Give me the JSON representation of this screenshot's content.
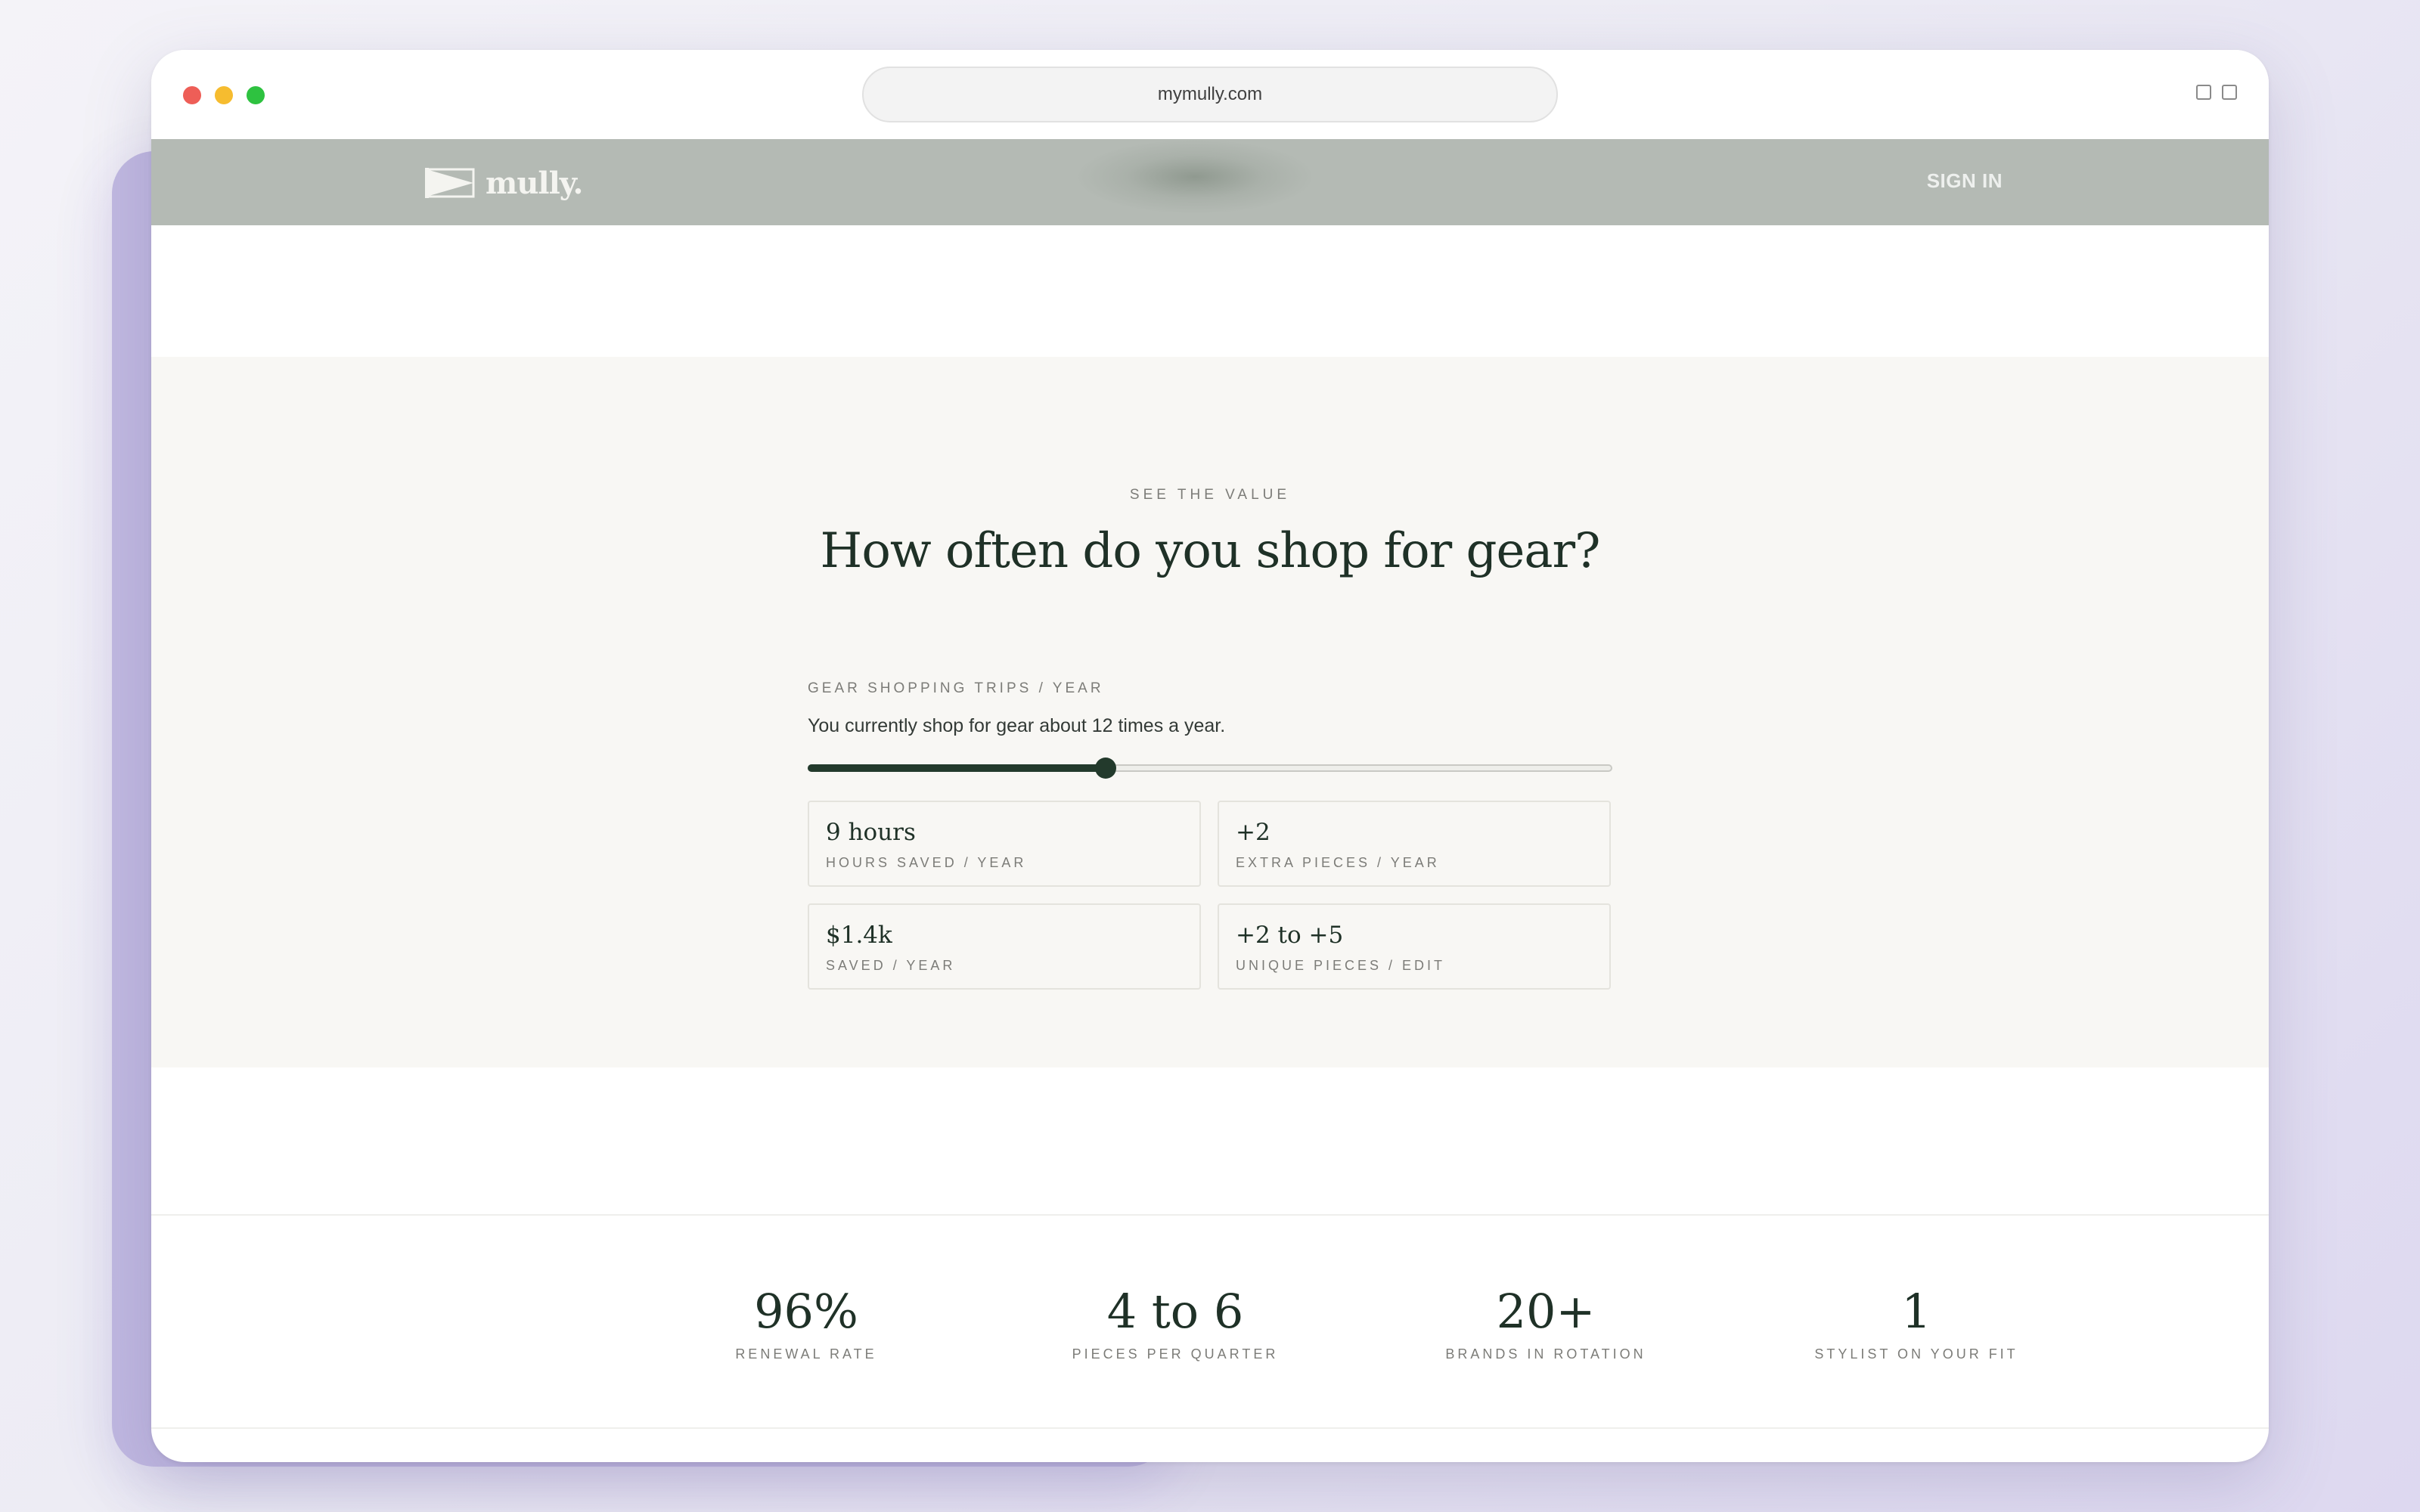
{
  "browser": {
    "url": "mymully.com",
    "traffic_lights": {
      "close": "#ee5e57",
      "minimize": "#f6bc2f",
      "maximize": "#2ec240"
    }
  },
  "site_header": {
    "logo_text": "mully.",
    "signin_label": "SIGN IN"
  },
  "value_section": {
    "eyebrow": "SEE THE VALUE",
    "headline": "How often do you shop for gear?",
    "calculator": {
      "label": "GEAR SHOPPING TRIPS / YEAR",
      "description": "You currently shop for gear about 12 times a year.",
      "slider_value_fraction": 0.37,
      "stats": [
        {
          "value": "9 hours",
          "label": "HOURS SAVED / YEAR"
        },
        {
          "value": "+2",
          "label": "EXTRA PIECES / YEAR"
        },
        {
          "value": "$1.4k",
          "label": "SAVED / YEAR"
        },
        {
          "value": "+2 to +5",
          "label": "UNIQUE PIECES / EDIT"
        }
      ]
    }
  },
  "metrics": [
    {
      "value": "96%",
      "label": "RENEWAL RATE"
    },
    {
      "value": "4 to 6",
      "label": "PIECES PER QUARTER"
    },
    {
      "value": "20+",
      "label": "BRANDS IN ROTATION"
    },
    {
      "value": "1",
      "label": "STYLIST ON YOUR FIT"
    }
  ],
  "colors": {
    "brand_green": "#1f3127",
    "header_bg": "#b4bab4",
    "section_bg": "#f8f7f4"
  }
}
